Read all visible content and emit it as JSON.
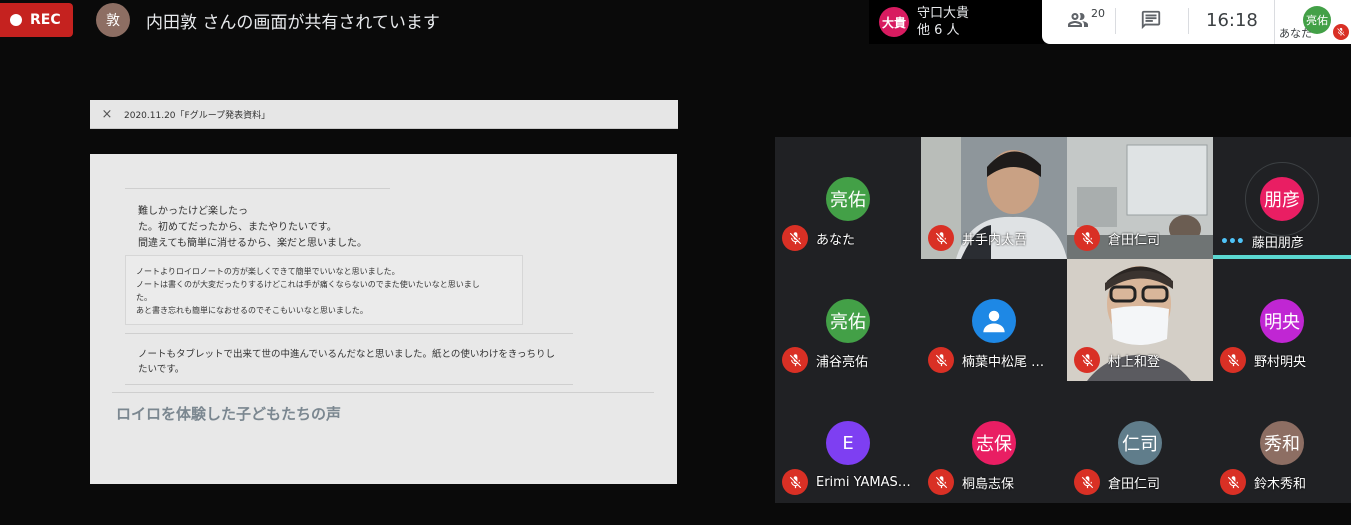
{
  "recording": {
    "label": "REC"
  },
  "presenter": {
    "initial": "敦",
    "banner": "内田敦 さんの画面が共有されています"
  },
  "active_speaker": {
    "initials": "大貴",
    "name": "守口大貴",
    "others": "他 6 人"
  },
  "topbar": {
    "people_count": "20",
    "time": "16:18",
    "self": {
      "initials": "亮佑",
      "label": "あなた"
    }
  },
  "document": {
    "close_glyph": "×",
    "title": "2020.11.20「Fグループ発表資料」",
    "lines": [
      "難しかったけど楽したっ",
      "た。初めてだったから、またやりたいです。",
      "間違えても簡単に消せるから、楽だと思いました。"
    ],
    "box_lines": [
      "ノートよりロイロノートの方が楽しくできて簡単でいいなと思いました。",
      "ノートは書くのが大変だったりするけどこれは手が痛くならないのでまた使いたいなと思いまし",
      "た。",
      "あと書き忘れも簡単になおせるのでそこもいいなと思いました。"
    ],
    "bottom_lines": [
      "ノートもタブレットで出来て世の中進んでいるんだなと思いました。紙との使いわけをきっちりし",
      "たいです。"
    ],
    "heading": "ロイロを体験した子どもたちの声"
  },
  "participants": [
    {
      "name": "あなた",
      "initials": "亮佑",
      "color": "#43a047",
      "video": false
    },
    {
      "name": "井手内太吾",
      "initials": "",
      "color": "",
      "video": true
    },
    {
      "name": "倉田仁司",
      "initials": "",
      "color": "",
      "video": true
    },
    {
      "name": "藤田朋彦",
      "initials": "朋彦",
      "color": "#e91e63",
      "video": false,
      "speaking": true
    },
    {
      "name": "浦谷亮佑",
      "initials": "亮佑",
      "color": "#43a047",
      "video": false
    },
    {
      "name": "楠葉中松尾 …",
      "initials": "",
      "color": "#1e88e5",
      "video": false,
      "icon": "person-icon"
    },
    {
      "name": "村上和登",
      "initials": "",
      "color": "",
      "video": true
    },
    {
      "name": "野村明央",
      "initials": "明央",
      "color": "#c026d3",
      "video": false
    },
    {
      "name": "Erimi YAMAS…",
      "initials": "E",
      "color": "#7e3ff2",
      "video": false
    },
    {
      "name": "桐島志保",
      "initials": "志保",
      "color": "#e91e63",
      "video": false
    },
    {
      "name": "倉田仁司",
      "initials": "仁司",
      "color": "#607d8b",
      "video": false
    },
    {
      "name": "鈴木秀和",
      "initials": "秀和",
      "color": "#8d6e63",
      "video": false
    }
  ]
}
